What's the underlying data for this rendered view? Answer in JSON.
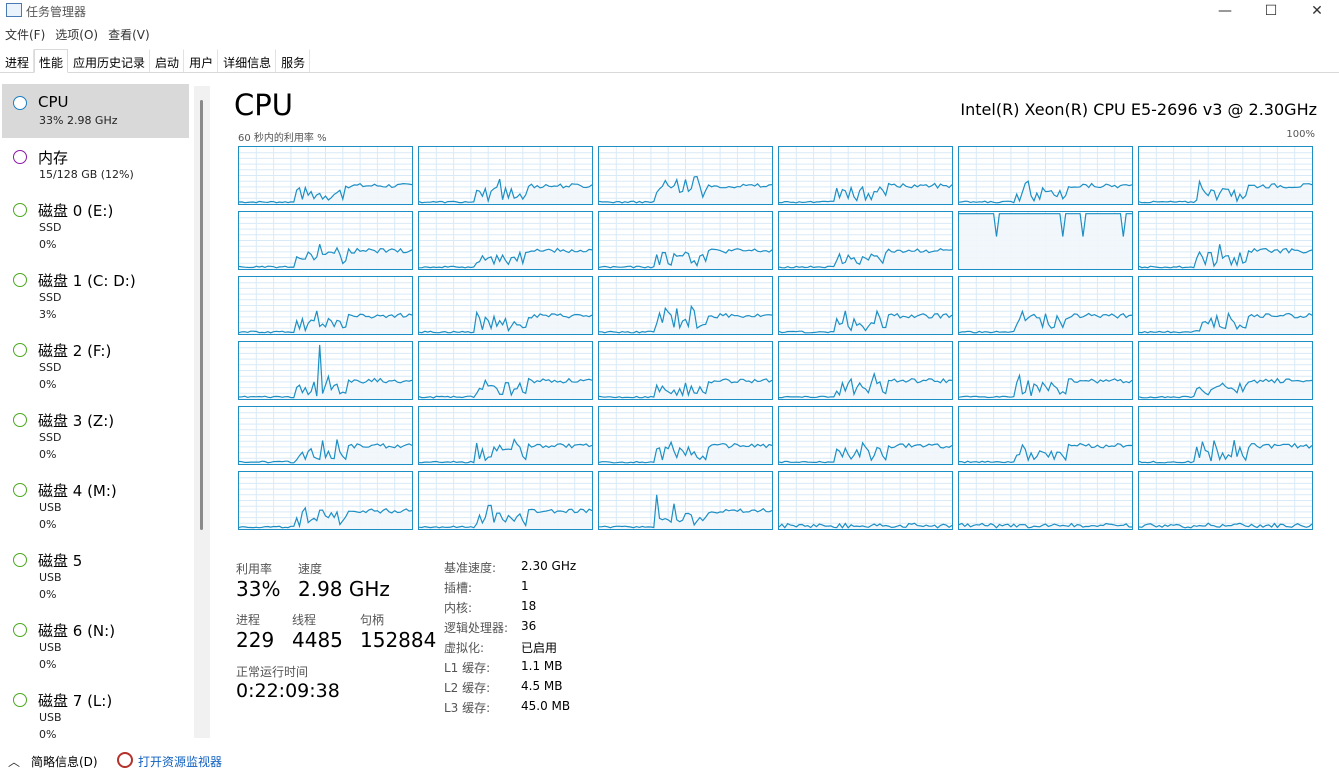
{
  "window": {
    "title": "任务管理器"
  },
  "menu": [
    "文件(F)",
    "选项(O)",
    "查看(V)"
  ],
  "tabs": [
    {
      "label": "进程",
      "active": false
    },
    {
      "label": "性能",
      "active": true
    },
    {
      "label": "应用历史记录",
      "active": false
    },
    {
      "label": "启动",
      "active": false
    },
    {
      "label": "用户",
      "active": false
    },
    {
      "label": "详细信息",
      "active": false
    },
    {
      "label": "服务",
      "active": false
    }
  ],
  "sidebar": {
    "items": [
      {
        "name": "CPU",
        "sub1": "33%  2.98 GHz",
        "sub2": "",
        "color": "#1a7fc1",
        "selected": true
      },
      {
        "name": "内存",
        "sub1": "15/128 GB (12%)",
        "sub2": "",
        "color": "#8b18a8",
        "selected": false
      },
      {
        "name": "磁盘 0 (E:)",
        "sub1": "SSD",
        "sub2": "0%",
        "color": "#4ca821",
        "selected": false
      },
      {
        "name": "磁盘 1 (C: D:)",
        "sub1": "SSD",
        "sub2": "3%",
        "color": "#4ca821",
        "selected": false
      },
      {
        "name": "磁盘 2 (F:)",
        "sub1": "SSD",
        "sub2": "0%",
        "color": "#4ca821",
        "selected": false
      },
      {
        "name": "磁盘 3 (Z:)",
        "sub1": "SSD",
        "sub2": "0%",
        "color": "#4ca821",
        "selected": false
      },
      {
        "name": "磁盘 4 (M:)",
        "sub1": "USB",
        "sub2": "0%",
        "color": "#4ca821",
        "selected": false
      },
      {
        "name": "磁盘 5",
        "sub1": "USB",
        "sub2": "0%",
        "color": "#4ca821",
        "selected": false
      },
      {
        "name": "磁盘 6 (N:)",
        "sub1": "USB",
        "sub2": "0%",
        "color": "#4ca821",
        "selected": false
      },
      {
        "name": "磁盘 7 (L:)",
        "sub1": "USB",
        "sub2": "0%",
        "color": "#4ca821",
        "selected": false
      }
    ]
  },
  "main": {
    "title": "CPU",
    "model": "Intel(R) Xeon(R) CPU E5-2696 v3 @ 2.30GHz",
    "util_label": "60 秒内的利用率 %",
    "util_max": "100%",
    "graph_colors": {
      "line": "#1d8fc4",
      "fill": "#f1f6fb",
      "grid": "#d9eaf7"
    },
    "stats": {
      "utilization": {
        "label": "利用率",
        "value": "33%"
      },
      "speed": {
        "label": "速度",
        "value": "2.98 GHz"
      },
      "processes": {
        "label": "进程",
        "value": "229"
      },
      "threads": {
        "label": "线程",
        "value": "4485"
      },
      "handles": {
        "label": "句柄",
        "value": "152884"
      },
      "uptime": {
        "label": "正常运行时间",
        "value": "0:22:09:38"
      }
    },
    "info": [
      {
        "label": "基准速度:",
        "value": "2.30 GHz"
      },
      {
        "label": "插槽:",
        "value": "1"
      },
      {
        "label": "内核:",
        "value": "18"
      },
      {
        "label": "逻辑处理器:",
        "value": "36"
      },
      {
        "label": "虚拟化:",
        "value": "已启用"
      },
      {
        "label": "L1 缓存:",
        "value": "1.1 MB"
      },
      {
        "label": "L2 缓存:",
        "value": "4.5 MB"
      },
      {
        "label": "L3 缓存:",
        "value": "45.0 MB"
      }
    ]
  },
  "bottom": {
    "brief": "简略信息(D)",
    "monitor": "打开资源监视器"
  }
}
